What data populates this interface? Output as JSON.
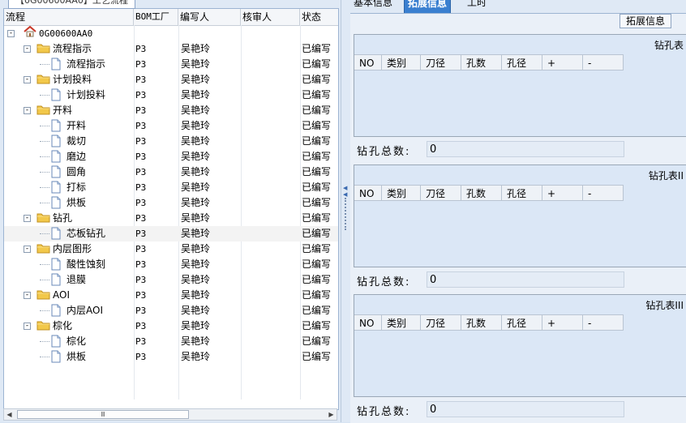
{
  "left_panel": {
    "tab_label": "【0G00600AA0】工艺流程",
    "columns": [
      "流程",
      "BOM工厂",
      "编写人",
      "核审人",
      "状态"
    ],
    "root_label": "0G00600AA0",
    "rows": [
      {
        "label": "流程指示",
        "bom": "P3",
        "author": "吴艳玲",
        "status": "已编写"
      },
      {
        "label": "流程指示",
        "bom": "P3",
        "author": "吴艳玲",
        "status": "已编写"
      },
      {
        "label": "计划投料",
        "bom": "P3",
        "author": "吴艳玲",
        "status": "已编写"
      },
      {
        "label": "计划投料",
        "bom": "P3",
        "author": "吴艳玲",
        "status": "已编写"
      },
      {
        "label": "开料",
        "bom": "P3",
        "author": "吴艳玲",
        "status": "已编写"
      },
      {
        "label": "开料",
        "bom": "P3",
        "author": "吴艳玲",
        "status": "已编写"
      },
      {
        "label": "裁切",
        "bom": "P3",
        "author": "吴艳玲",
        "status": "已编写"
      },
      {
        "label": "磨边",
        "bom": "P3",
        "author": "吴艳玲",
        "status": "已编写"
      },
      {
        "label": "圆角",
        "bom": "P3",
        "author": "吴艳玲",
        "status": "已编写"
      },
      {
        "label": "打标",
        "bom": "P3",
        "author": "吴艳玲",
        "status": "已编写"
      },
      {
        "label": "烘板",
        "bom": "P3",
        "author": "吴艳玲",
        "status": "已编写"
      },
      {
        "label": "钻孔",
        "bom": "P3",
        "author": "吴艳玲",
        "status": "已编写"
      },
      {
        "label": "芯板钻孔",
        "bom": "P3",
        "author": "吴艳玲",
        "status": "已编写"
      },
      {
        "label": "内层图形",
        "bom": "P3",
        "author": "吴艳玲",
        "status": "已编写"
      },
      {
        "label": "酸性蚀刻",
        "bom": "P3",
        "author": "吴艳玲",
        "status": "已编写"
      },
      {
        "label": "退膜",
        "bom": "P3",
        "author": "吴艳玲",
        "status": "已编写"
      },
      {
        "label": "AOI",
        "bom": "P3",
        "author": "吴艳玲",
        "status": "已编写"
      },
      {
        "label": "内层AOI",
        "bom": "P3",
        "author": "吴艳玲",
        "status": "已编写"
      },
      {
        "label": "棕化",
        "bom": "P3",
        "author": "吴艳玲",
        "status": "已编写"
      },
      {
        "label": "棕化",
        "bom": "P3",
        "author": "吴艳玲",
        "status": "已编写"
      },
      {
        "label": "烘板",
        "bom": "P3",
        "author": "吴艳玲",
        "status": "已编写"
      }
    ],
    "scroll_thumb_glyph": "Ⅲ"
  },
  "right_panel": {
    "tabs": [
      "基本信息",
      "拓展信息",
      "工时"
    ],
    "extend_button": "拓展信息",
    "grid_columns": [
      "NO",
      "类别",
      "刀径",
      "孔数",
      "孔径",
      "+",
      "-"
    ],
    "groups": [
      {
        "title": "钻孔表",
        "sum_label": "钻孔总数:",
        "sum_value": "0"
      },
      {
        "title": "钻孔表II",
        "sum_label": "钻孔总数:",
        "sum_value": "0"
      },
      {
        "title": "钻孔表III",
        "sum_label": "钻孔总数:",
        "sum_value": "0"
      }
    ]
  },
  "colors": {
    "accent": "#3a7fd0",
    "folder": "#f0c040",
    "home": "#d04030"
  }
}
